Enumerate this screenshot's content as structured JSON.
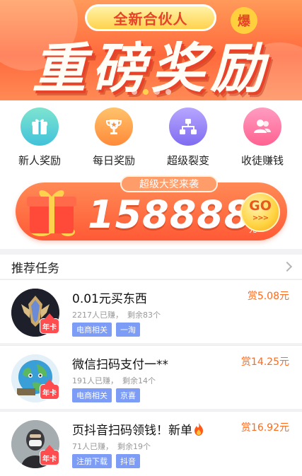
{
  "hero": {
    "pill_text": "全新合伙人",
    "burst_text": "爆",
    "headline": "重磅奖励",
    "carousel_dots": 4,
    "active_dot": 1
  },
  "shortcuts": [
    {
      "label": "新人奖励",
      "icon": "gift-icon",
      "color_top": "#7ee4d0",
      "color_bottom": "#41c2d9"
    },
    {
      "label": "每日奖励",
      "icon": "trophy-icon",
      "color_top": "#ffc36b",
      "color_bottom": "#ff8a3a"
    },
    {
      "label": "超级裂变",
      "icon": "hierarchy-icon",
      "color_top": "#b7a6ff",
      "color_bottom": "#7f6cf0"
    },
    {
      "label": "收徒赚钱",
      "icon": "users-icon",
      "color_top": "#ff9cc1",
      "color_bottom": "#ff6291"
    }
  ],
  "jackpot": {
    "tag": "超级大奖来袭",
    "amount": "158888",
    "unit": "元",
    "go_label": "GO",
    "go_arrows": ">>>"
  },
  "recommended": {
    "title": "推荐任务"
  },
  "tasks": [
    {
      "title": "0.01元买东西",
      "earned": "2217人已赚，",
      "remaining": "剩余83个",
      "tags": [
        "电商相关",
        "一淘"
      ],
      "reward": "赏5.08元",
      "badge": "年卡",
      "avatar": "trophy-avatar-icon"
    },
    {
      "title": "微信扫码支付一**",
      "earned": "191人已赚，",
      "remaining": "剩余14个",
      "tags": [
        "电商相关",
        "京喜"
      ],
      "reward": "赏14.25元",
      "badge": "年卡",
      "avatar": "earth-avatar-icon"
    },
    {
      "title": "页抖音扫码领钱！新单",
      "earned": "71人已赚，",
      "remaining": "剩余19个",
      "tags": [
        "注册下载",
        "抖音"
      ],
      "reward": "赏16.92元",
      "badge": "年卡",
      "avatar": "person-avatar-icon",
      "has_fire": true
    }
  ],
  "colors": {
    "accent_orange": "#ff6a1a",
    "tag_blue": "#7d9cf5",
    "hero_red": "#e8432a"
  }
}
